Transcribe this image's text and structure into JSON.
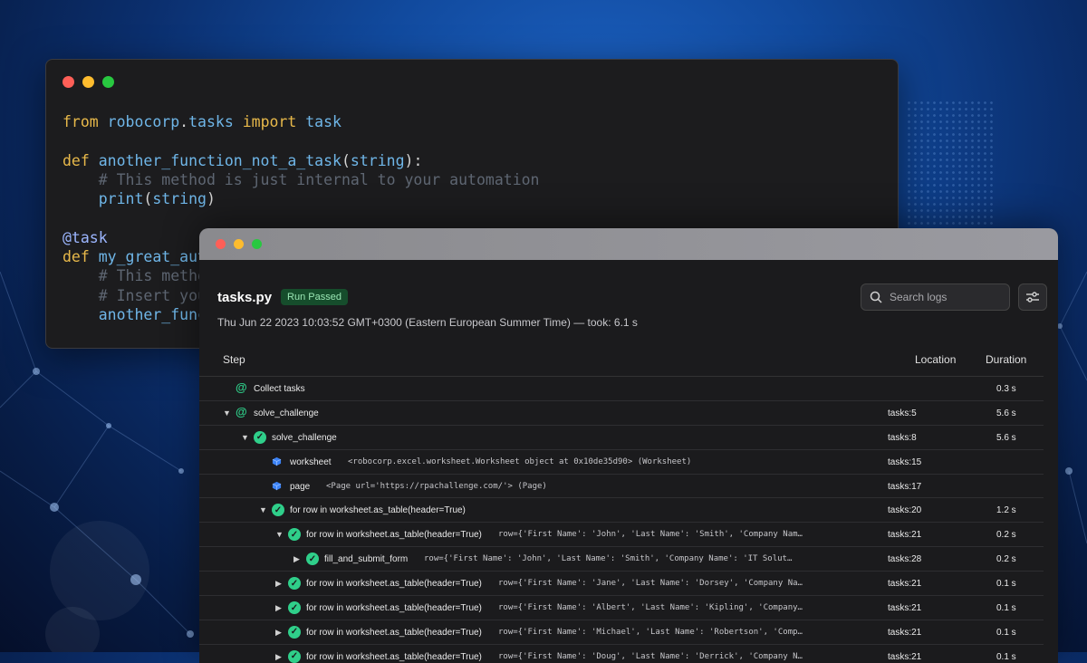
{
  "code_window": {
    "lines": [
      [
        {
          "t": "from ",
          "c": "kw"
        },
        {
          "t": "robocorp",
          "c": "fn"
        },
        {
          "t": ".",
          "c": ""
        },
        {
          "t": "tasks",
          "c": "fn"
        },
        {
          "t": " import ",
          "c": "kw"
        },
        {
          "t": "task",
          "c": "fn"
        }
      ],
      [],
      [
        {
          "t": "def ",
          "c": "kw"
        },
        {
          "t": "another_function_not_a_task",
          "c": "fn"
        },
        {
          "t": "(",
          "c": ""
        },
        {
          "t": "string",
          "c": "fn"
        },
        {
          "t": "):",
          "c": ""
        }
      ],
      [
        {
          "t": "    # This method is just internal to your automation",
          "c": "cm"
        }
      ],
      [
        {
          "t": "    ",
          "c": ""
        },
        {
          "t": "print",
          "c": "fn"
        },
        {
          "t": "(",
          "c": ""
        },
        {
          "t": "string",
          "c": "fn"
        },
        {
          "t": ")",
          "c": ""
        }
      ],
      [],
      [
        {
          "t": "@task",
          "c": "dec"
        }
      ],
      [
        {
          "t": "def ",
          "c": "kw"
        },
        {
          "t": "my_great_aut",
          "c": "fn"
        }
      ],
      [
        {
          "t": "    # This metho",
          "c": "cm"
        }
      ],
      [
        {
          "t": "    # Insert you",
          "c": "cm"
        }
      ],
      [
        {
          "t": "    ",
          "c": ""
        },
        {
          "t": "another_func",
          "c": "fn"
        }
      ]
    ]
  },
  "log_window": {
    "title": "tasks.py",
    "status_badge": "Run Passed",
    "subtitle": "Thu Jun 22 2023 10:03:52 GMT+0300 (Eastern European Summer Time) — took: 6.1 s",
    "search_placeholder": "Search logs",
    "columns": {
      "step": "Step",
      "location": "Location",
      "duration": "Duration"
    },
    "rows": [
      {
        "indent": 0,
        "arrow": "",
        "icon": "at-icon",
        "name": "Collect tasks",
        "detail": "",
        "location": "",
        "duration": "0.3 s"
      },
      {
        "indent": 0,
        "arrow": "▼",
        "icon": "at-icon",
        "name": "solve_challenge",
        "detail": "",
        "location": "tasks:5",
        "duration": "5.6 s"
      },
      {
        "indent": 1,
        "arrow": "▼",
        "icon": "check-icon",
        "name": "solve_challenge",
        "detail": "",
        "location": "tasks:8",
        "duration": "5.6 s"
      },
      {
        "indent": 2,
        "arrow": "",
        "icon": "cube-icon",
        "name": "worksheet",
        "detail": "<robocorp.excel.worksheet.Worksheet object at 0x10de35d90> (Worksheet)",
        "location": "tasks:15",
        "duration": ""
      },
      {
        "indent": 2,
        "arrow": "",
        "icon": "cube-icon",
        "name": "page",
        "detail": "<Page url='https://rpachallenge.com/'> (Page)",
        "location": "tasks:17",
        "duration": ""
      },
      {
        "indent": 2,
        "arrow": "▼",
        "icon": "check-icon",
        "name": "for row in worksheet.as_table(header=True)",
        "detail": "",
        "location": "tasks:20",
        "duration": "1.2 s"
      },
      {
        "indent": 3,
        "arrow": "▼",
        "icon": "check-icon",
        "name": "for row in worksheet.as_table(header=True)",
        "detail": "row={'First Name': 'John', 'Last Name': 'Smith', 'Company Nam…",
        "location": "tasks:21",
        "duration": "0.2 s"
      },
      {
        "indent": 4,
        "arrow": "▶",
        "icon": "check-icon",
        "name": "fill_and_submit_form",
        "detail": "row={'First Name': 'John', 'Last Name': 'Smith', 'Company Name': 'IT Solut…",
        "location": "tasks:28",
        "duration": "0.2 s"
      },
      {
        "indent": 3,
        "arrow": "▶",
        "icon": "check-icon",
        "name": "for row in worksheet.as_table(header=True)",
        "detail": "row={'First Name': 'Jane', 'Last Name': 'Dorsey', 'Company Na…",
        "location": "tasks:21",
        "duration": "0.1 s"
      },
      {
        "indent": 3,
        "arrow": "▶",
        "icon": "check-icon",
        "name": "for row in worksheet.as_table(header=True)",
        "detail": "row={'First Name': 'Albert', 'Last Name': 'Kipling', 'Company…",
        "location": "tasks:21",
        "duration": "0.1 s"
      },
      {
        "indent": 3,
        "arrow": "▶",
        "icon": "check-icon",
        "name": "for row in worksheet.as_table(header=True)",
        "detail": "row={'First Name': 'Michael', 'Last Name': 'Robertson', 'Comp…",
        "location": "tasks:21",
        "duration": "0.1 s"
      },
      {
        "indent": 3,
        "arrow": "▶",
        "icon": "check-icon",
        "name": "for row in worksheet.as_table(header=True)",
        "detail": "row={'First Name': 'Doug', 'Last Name': 'Derrick', 'Company N…",
        "location": "tasks:21",
        "duration": "0.1 s"
      }
    ]
  }
}
